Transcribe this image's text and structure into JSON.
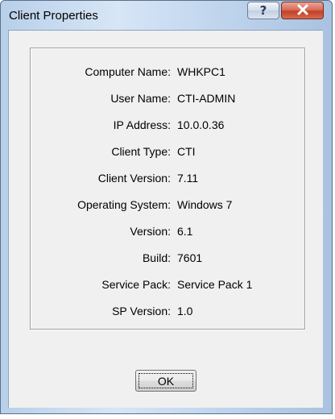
{
  "window": {
    "title": "Client Properties",
    "help_glyph": "?",
    "close_icon": "close-icon"
  },
  "properties": [
    {
      "label": "Computer Name:",
      "value": "WHKPC1"
    },
    {
      "label": "User Name:",
      "value": "CTI-ADMIN"
    },
    {
      "label": "IP Address:",
      "value": "10.0.0.36"
    },
    {
      "label": "Client Type:",
      "value": "CTI"
    },
    {
      "label": "Client Version:",
      "value": "7.11"
    },
    {
      "label": "Operating System:",
      "value": "Windows 7"
    },
    {
      "label": "Version:",
      "value": "6.1"
    },
    {
      "label": "Build:",
      "value": "7601"
    },
    {
      "label": "Service Pack:",
      "value": "Service Pack 1"
    },
    {
      "label": "SP Version:",
      "value": "1.0"
    }
  ],
  "buttons": {
    "ok_label": "OK"
  },
  "colors": {
    "close_button": "#c2402a",
    "title_bar": "#c4d8ef"
  }
}
